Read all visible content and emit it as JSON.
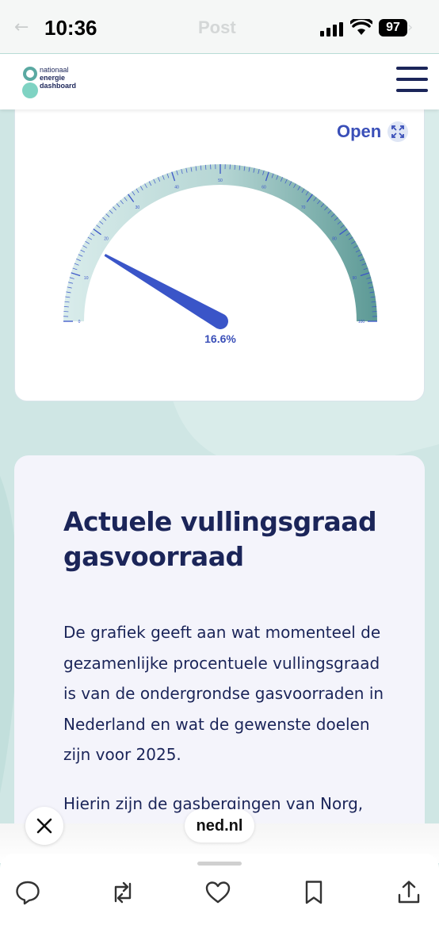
{
  "status_bar": {
    "time": "10:36",
    "title": "Post",
    "battery": "97"
  },
  "site": {
    "logo_lines": [
      "nationaal",
      "energie",
      "dashboard"
    ]
  },
  "gauge": {
    "open_label": "Open",
    "value_label": "16.6%",
    "min": 0,
    "max": 100,
    "value": 16.6,
    "tick_labels": [
      "0",
      "10",
      "20",
      "30",
      "40",
      "50",
      "60",
      "70",
      "80",
      "90",
      "100"
    ],
    "colors": {
      "arc_start": "#d6e9e8",
      "arc_end": "#5e9e9a",
      "needle": "#3a55c8",
      "ticks": "#3a55c8"
    }
  },
  "info_card": {
    "title": "Actuele vullingsgraad gasvoorraad",
    "paragraph1": "De grafiek geeft aan wat momenteel de gezamenlijke procentuele vullingsgraad is van de ondergrondse gasvoorraden in Nederland en wat de gewenste doelen zijn voor 2025.",
    "paragraph2": "Hierin zijn de gasbergingen van Norg,"
  },
  "overlay": {
    "url": "ned.nl"
  },
  "actions": [
    "reply-icon",
    "repost-icon",
    "like-icon",
    "bookmark-icon",
    "share-icon"
  ]
}
